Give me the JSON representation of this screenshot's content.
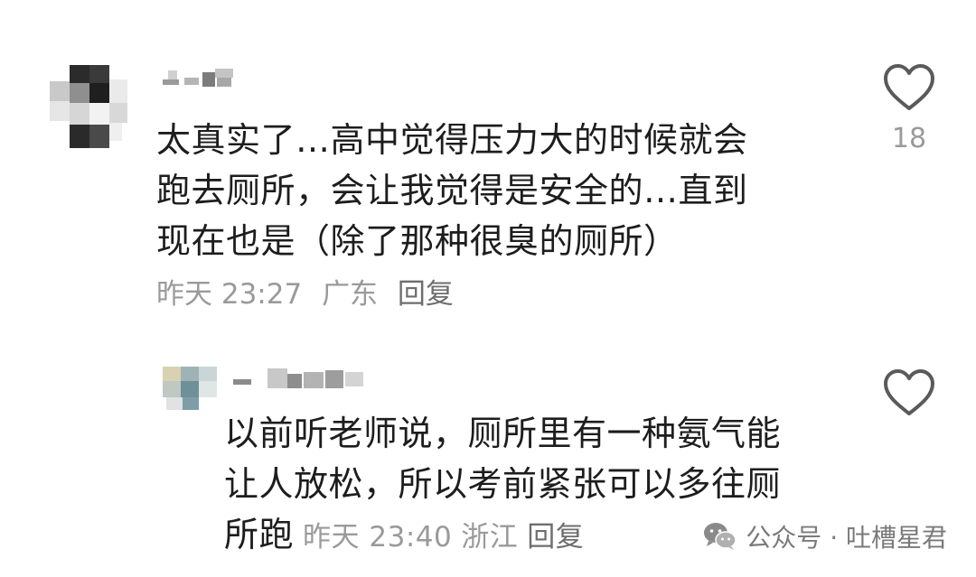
{
  "comment": {
    "text_lines": [
      "太真实了…高中觉得压力大的时候就会",
      "跑去厕所，会让我觉得是安全的…直到",
      "现在也是（除了那种很臭的厕所）"
    ],
    "time": "昨天 23:27",
    "location": "广东",
    "reply_label": "回复",
    "like_count": "18"
  },
  "reply": {
    "text_lines": [
      "以前听老师说，厕所里有一种氨气能",
      "让人放松，所以考前紧张可以多往厕"
    ],
    "text_last": "所跑",
    "time": "昨天 23:40",
    "location": "浙江",
    "reply_label": "回复"
  },
  "watermark": {
    "text": "公众号 · 吐槽星君",
    "icon": "wechat-icon"
  },
  "icons": {
    "like": "heart-outline-icon"
  }
}
